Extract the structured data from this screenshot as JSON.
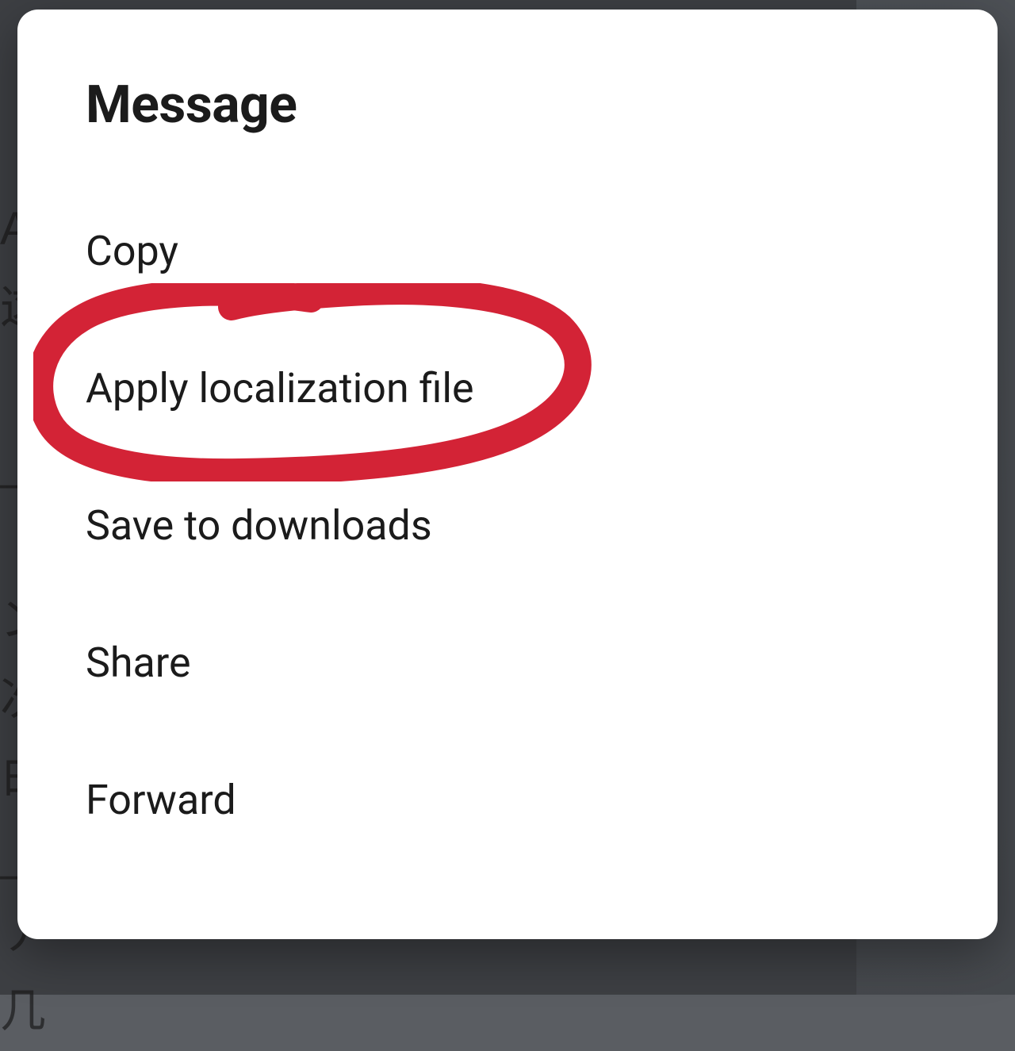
{
  "dialog": {
    "title": "Message",
    "items": [
      "Copy",
      "Apply localization file",
      "Save to downloads",
      "Share",
      "Forward"
    ]
  },
  "annotation": {
    "highlighted_item_index": 1,
    "circle_color": "#d32336"
  }
}
